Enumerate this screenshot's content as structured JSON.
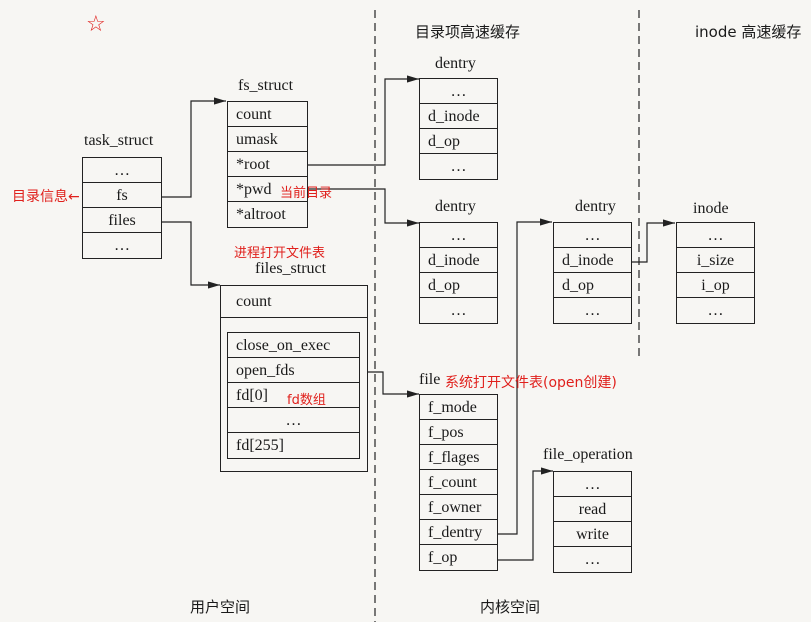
{
  "regions": {
    "user_space": "用户空间",
    "kernel_space": "内核空间",
    "dentry_cache": "目录项高速缓存",
    "inode_cache": "inode 高速缓存"
  },
  "task_struct": {
    "title": "task_struct",
    "fields": [
      "…",
      "fs",
      "files",
      "…"
    ]
  },
  "fs_struct": {
    "title": "fs_struct",
    "fields": [
      "count",
      "umask",
      "*root",
      "*pwd",
      "*altroot"
    ]
  },
  "files_struct": {
    "title": "files_struct",
    "count": "count",
    "fields": [
      "close_on_exec",
      "open_fds",
      "fd[0]",
      "…",
      "fd[255]"
    ]
  },
  "dentry1": {
    "title": "dentry",
    "fields": [
      "…",
      "d_inode",
      "d_op",
      "…"
    ]
  },
  "dentry2": {
    "title": "dentry",
    "fields": [
      "…",
      "d_inode",
      "d_op",
      "…"
    ]
  },
  "dentry3": {
    "title": "dentry",
    "fields": [
      "…",
      "d_inode",
      "d_op",
      "…"
    ]
  },
  "inode": {
    "title": "inode",
    "fields": [
      "…",
      "i_size",
      "i_op",
      "…"
    ]
  },
  "file": {
    "title": "file",
    "fields": [
      "f_mode",
      "f_pos",
      "f_flages",
      "f_count",
      "f_owner",
      "f_dentry",
      "f_op"
    ]
  },
  "file_operation": {
    "title": "file_operation",
    "fields": [
      "…",
      "read",
      "write",
      "…"
    ]
  },
  "annotations": {
    "star": "☆",
    "fs_note": "目录信息←",
    "pwd_note": "当前目录",
    "files_note": "进程打开文件表",
    "fd_note": "fd数组",
    "file_note": "系统打开文件表(open创建)"
  },
  "colors": {
    "annotation": "#e0201c",
    "line": "#222222"
  }
}
